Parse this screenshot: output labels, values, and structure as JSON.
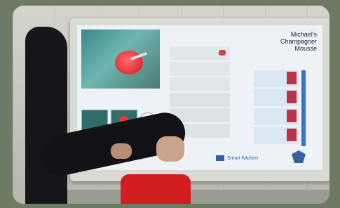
{
  "recipe": {
    "title_line1": "Michael's",
    "title_line2": "Champagner",
    "title_line3": "Mousse"
  },
  "branding": {
    "name": "Smart Kitchen"
  },
  "colors": {
    "accent": "#2d5fb0",
    "bowl": "#d41818"
  },
  "icons": [
    "video-feed",
    "play-control",
    "recipe-step-marker",
    "ingredient-thumbnail",
    "university-logo"
  ]
}
